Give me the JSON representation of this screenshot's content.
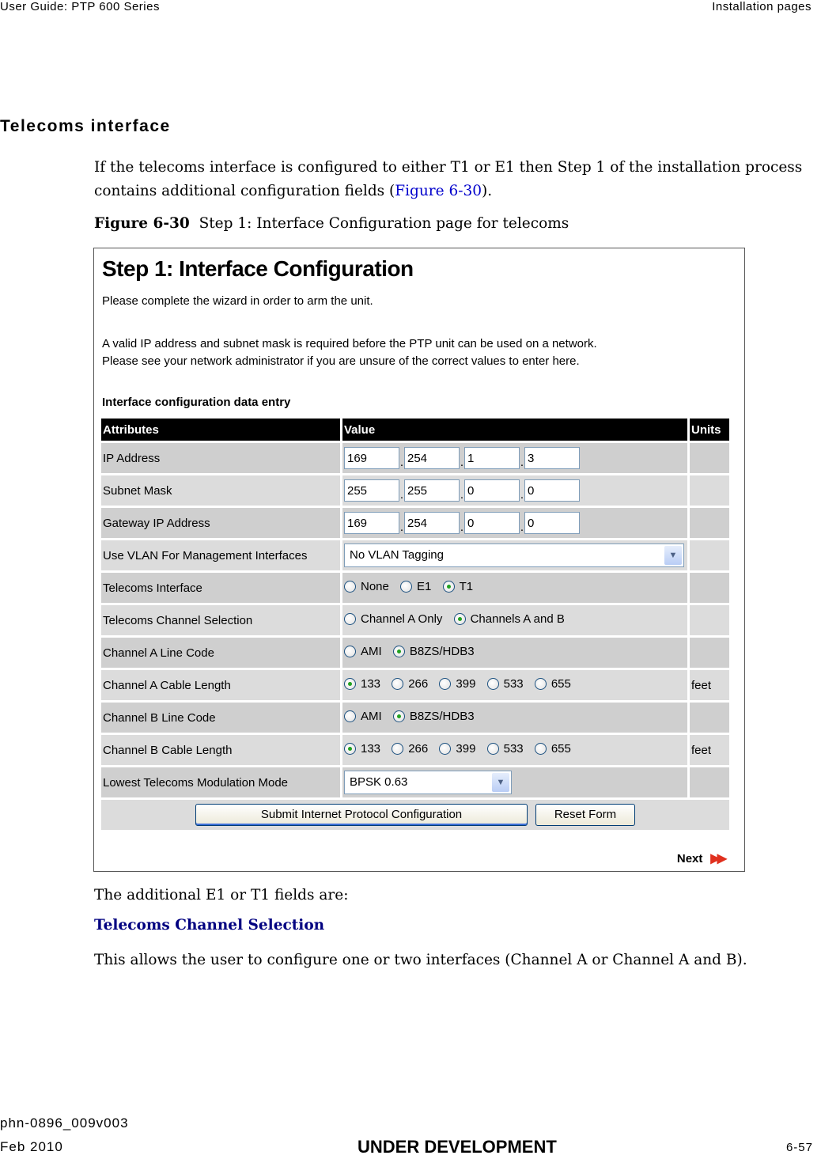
{
  "header": {
    "left": "User Guide: PTP 600 Series",
    "right": "Installation pages"
  },
  "section_title": "Telecoms interface",
  "intro": {
    "before_link": "If the telecoms interface is configured to either T1 or E1 then Step 1 of the installation process contains additional configuration fields (",
    "link": "Figure 6-30",
    "after_link": ")."
  },
  "figure": {
    "label": "Figure 6-30",
    "caption": "Step 1: Interface Configuration page for telecoms"
  },
  "screen": {
    "title": "Step 1: Interface Configuration",
    "text1": "Please complete the wizard in order to arm the unit.",
    "text2": "A valid IP address and subnet mask is required before the PTP unit can be used on a network. Please see your network administrator if you are unsure of the correct values to enter here.",
    "subtitle": "Interface configuration data entry",
    "columns": [
      "Attributes",
      "Value",
      "Units"
    ],
    "ip_address": {
      "label": "IP Address",
      "octets": [
        "169",
        "254",
        "1",
        "3"
      ]
    },
    "subnet_mask": {
      "label": "Subnet Mask",
      "octets": [
        "255",
        "255",
        "0",
        "0"
      ]
    },
    "gateway": {
      "label": "Gateway IP Address",
      "octets": [
        "169",
        "254",
        "0",
        "0"
      ]
    },
    "vlan": {
      "label": "Use VLAN For Management Interfaces",
      "selected": "No VLAN Tagging"
    },
    "telecoms_interface": {
      "label": "Telecoms Interface",
      "options": [
        "None",
        "E1",
        "T1"
      ],
      "selected": "T1"
    },
    "channel_selection": {
      "label": "Telecoms Channel Selection",
      "options": [
        "Channel A Only",
        "Channels A and B"
      ],
      "selected": "Channels A and B"
    },
    "a_line_code": {
      "label": "Channel A Line Code",
      "options": [
        "AMI",
        "B8ZS/HDB3"
      ],
      "selected": "B8ZS/HDB3"
    },
    "a_cable_length": {
      "label": "Channel A Cable Length",
      "options": [
        "133",
        "266",
        "399",
        "533",
        "655"
      ],
      "selected": "133",
      "units": "feet"
    },
    "b_line_code": {
      "label": "Channel B Line Code",
      "options": [
        "AMI",
        "B8ZS/HDB3"
      ],
      "selected": "B8ZS/HDB3"
    },
    "b_cable_length": {
      "label": "Channel B Cable Length",
      "options": [
        "133",
        "266",
        "399",
        "533",
        "655"
      ],
      "selected": "133",
      "units": "feet"
    },
    "modulation": {
      "label": "Lowest Telecoms Modulation Mode",
      "selected": "BPSK 0.63"
    },
    "submit_label": "Submit Internet Protocol Configuration",
    "reset_label": "Reset Form",
    "next_label": "Next",
    "next_icon": "double-arrow-right"
  },
  "after_text": "The additional E1 or T1 fields are:",
  "subheading": "Telecoms Channel Selection",
  "body_text": "This allows the user to configure one or two interfaces (Channel A or Channel A and B).",
  "footer": {
    "doc_id": "phn-0896_009v003",
    "date": "Feb 2010",
    "status": "UNDER DEVELOPMENT",
    "page": "6-57"
  }
}
